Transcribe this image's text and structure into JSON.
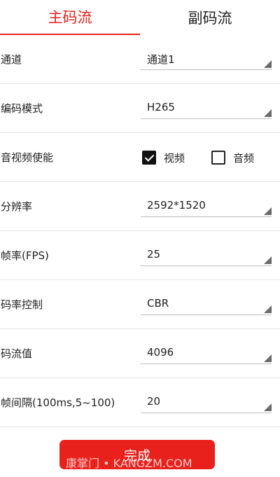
{
  "tabs": [
    {
      "label": "主码流",
      "active": true
    },
    {
      "label": "副码流",
      "active": false
    }
  ],
  "rows": {
    "channel": {
      "label": "通道",
      "value": "通道1"
    },
    "encode_mode": {
      "label": "编码模式",
      "value": "H265"
    },
    "av_enable": {
      "label": "音视频使能",
      "video": {
        "label": "视频",
        "checked": true
      },
      "audio": {
        "label": "音频",
        "checked": false
      }
    },
    "resolution": {
      "label": "分辨率",
      "value": "2592*1520"
    },
    "frame_rate": {
      "label": "帧率(FPS)",
      "value": "25"
    },
    "bitrate_control": {
      "label": "码率控制",
      "value": "CBR"
    },
    "bitrate_value": {
      "label": "码流值",
      "value": "4096"
    },
    "frame_interval": {
      "label": "帧间隔(100ms,5~100)",
      "value": "20"
    }
  },
  "done_button": {
    "label": "完成"
  },
  "watermark": "康掌门 • KANGZM.COM",
  "colors": {
    "accent": "#e8211d",
    "text": "#222222",
    "divider": "#e6e6e6",
    "select_underline": "#bdbdbd",
    "arrow": "#6b6b6b"
  },
  "icons": {
    "dropdown": "dropdown-triangle-icon",
    "checkbox_checked": "checkbox-checked-icon",
    "checkbox_unchecked": "checkbox-unchecked-icon"
  }
}
